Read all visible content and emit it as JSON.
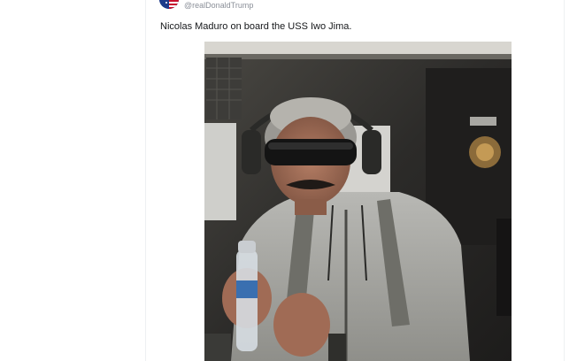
{
  "post": {
    "handle": "@realDonaldTrump",
    "text": "Nicolas Maduro on board the USS Iwo Jima.",
    "avatar_icon": "flag-avatar-icon",
    "media_icon": "photo-icon"
  },
  "colors": {
    "handle": "#8a8f98",
    "text": "#15171a",
    "border": "#eef0f2"
  }
}
